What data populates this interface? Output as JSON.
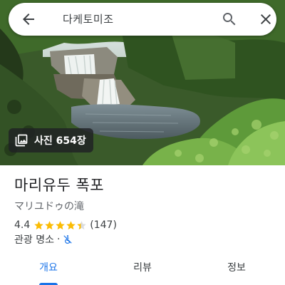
{
  "search": {
    "query": "다케토미조",
    "back_icon": "arrow-back-icon",
    "search_icon": "search-icon",
    "close_icon": "close-icon"
  },
  "photos": {
    "count_label": "사진 654장",
    "icon": "photo-library-icon"
  },
  "place": {
    "name": "마리유두 폭포",
    "alt_name": "マリユドゥの滝",
    "rating": "4.4",
    "stars_filled": 4.4,
    "review_count": "(147)",
    "category": "관광 명소",
    "separator": "·",
    "accessibility_icon": "not-accessible-icon"
  },
  "tabs": [
    {
      "label": "개요",
      "active": true
    },
    {
      "label": "리뷰",
      "active": false
    },
    {
      "label": "정보",
      "active": false
    }
  ],
  "colors": {
    "accent": "#1a73e8",
    "star": "#fbbc04",
    "accessibility": "#1a73e8"
  }
}
